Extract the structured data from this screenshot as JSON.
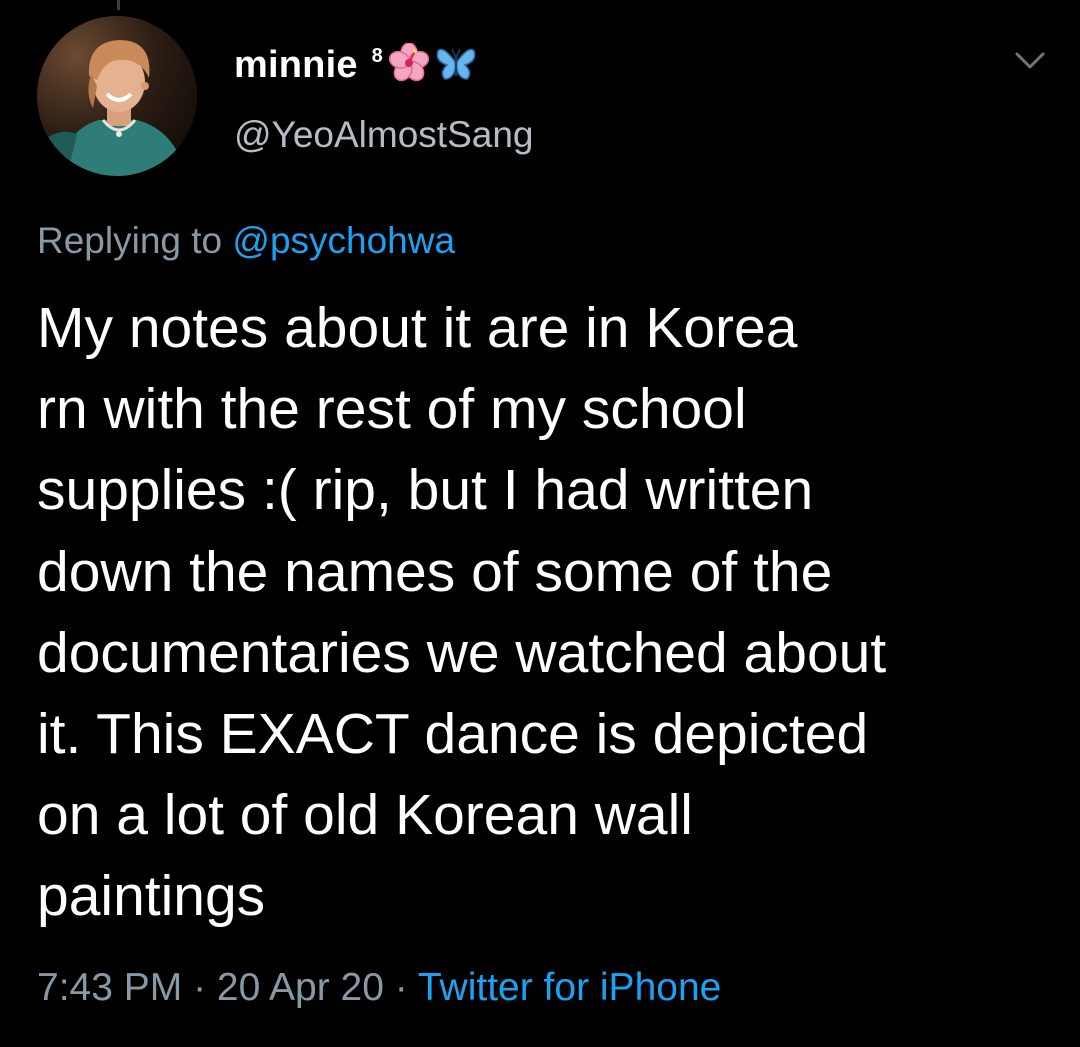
{
  "tweet": {
    "author": {
      "display_name": "minnie",
      "name_superscript": "8",
      "handle": "@YeoAlmostSang",
      "emoji_icons": [
        "hibiscus-icon",
        "butterfly-icon"
      ]
    },
    "reply": {
      "prefix": "Replying to",
      "target": "@psychohwa"
    },
    "text": "My notes about it are in Korea\nrn with the rest of my school\nsupplies :( rip, but I had written\ndown the names of some of the\ndocumentaries we watched about\nit. This EXACT dance is depicted\non a lot of old Korean wall\npaintings",
    "meta": {
      "time": "7:43 PM",
      "separator": " · ",
      "date": "20 Apr 20",
      "source": "Twitter for iPhone"
    }
  },
  "colors": {
    "background": "#000000",
    "text": "#ffffff",
    "muted": "#8899a6",
    "link": "#1da1f2"
  }
}
